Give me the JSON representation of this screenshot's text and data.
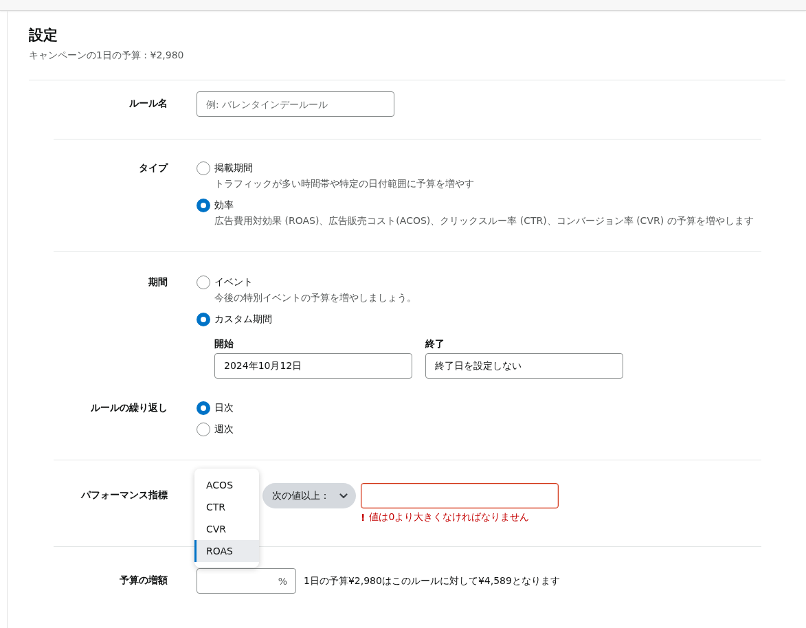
{
  "header": {
    "title": "設定",
    "subtitle": "キャンペーンの1日の予算 : ¥2,980"
  },
  "rule_name": {
    "label": "ルール名",
    "placeholder": "例: バレンタインデールール"
  },
  "type": {
    "label": "タイプ",
    "options": [
      {
        "label": "掲載期間",
        "description": "トラフィックが多い時間帯や特定の日付範囲に予算を増やす",
        "selected": false
      },
      {
        "label": "効率",
        "description": "広告費用対効果 (ROAS)、広告販売コスト(ACOS)、クリックスルー率 (CTR)、コンバージョン率 (CVR) の予算を増やします",
        "selected": true
      }
    ]
  },
  "period": {
    "label": "期間",
    "options": [
      {
        "label": "イベント",
        "description": "今後の特別イベントの予算を増やしましょう。",
        "selected": false
      },
      {
        "label": "カスタム期間",
        "selected": true
      }
    ],
    "start": {
      "label": "開始",
      "value": "2024年10月12日"
    },
    "end": {
      "label": "終了",
      "value": "終了日を設定しない"
    }
  },
  "repeat": {
    "label": "ルールの繰り返し",
    "options": [
      {
        "label": "日次",
        "selected": true
      },
      {
        "label": "週次",
        "selected": false
      }
    ]
  },
  "performance": {
    "label": "パフォーマンス指標",
    "menu": [
      {
        "label": "ACOS",
        "selected": false
      },
      {
        "label": "CTR",
        "selected": false
      },
      {
        "label": "CVR",
        "selected": false
      },
      {
        "label": "ROAS",
        "selected": true
      }
    ],
    "operator": "次の値以上：",
    "error_icon": "!",
    "error": "値は0より大きくなければなりません"
  },
  "budget": {
    "label": "予算の増額",
    "unit": "%",
    "note": "1日の予算¥2,980はこのルールに対して¥4,589となります"
  }
}
